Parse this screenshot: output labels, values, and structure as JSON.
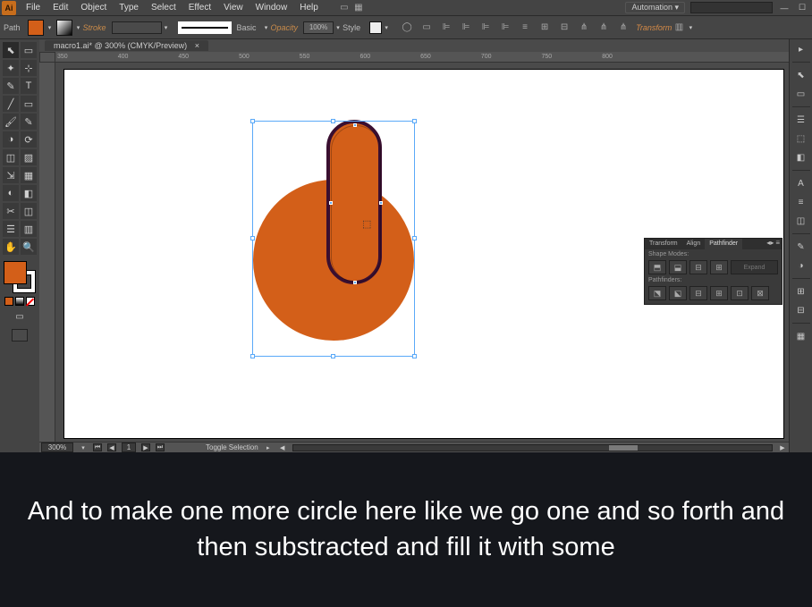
{
  "menubar": {
    "logo": "Ai",
    "items": [
      "File",
      "Edit",
      "Object",
      "Type",
      "Select",
      "Effect",
      "View",
      "Window",
      "Help"
    ],
    "automation_label": "Automation",
    "search_placeholder": ""
  },
  "controlbar": {
    "selection_label": "Path",
    "stroke_label": "Stroke",
    "line_style_label": "Basic",
    "opacity_label": "Opacity",
    "opacity_value": "100%",
    "style_label": "Style",
    "transform_label": "Transform"
  },
  "document": {
    "tab_title": "macro1.ai* @ 300% (CMYK/Preview)",
    "ruler_marks": [
      "350",
      "400",
      "450",
      "500",
      "550",
      "600",
      "650",
      "700",
      "750",
      "800"
    ],
    "zoom": "300%",
    "artboard_page": "1",
    "status_mode": "Toggle Selection"
  },
  "colors": {
    "fill": "#d35f19",
    "pill_stroke": "#3a0f30"
  },
  "tools_left": [
    [
      "⬉",
      "▭"
    ],
    [
      "✦",
      "⊹"
    ],
    [
      "✎",
      "T"
    ],
    [
      "╱",
      "▭"
    ],
    [
      "🖌",
      "✎"
    ],
    [
      "◑",
      "⟳"
    ],
    [
      "◫",
      "▨"
    ],
    [
      "⇲",
      "▦"
    ],
    [
      "◐",
      "◧"
    ],
    [
      "✂",
      "◫"
    ],
    [
      "☰",
      "▥"
    ],
    [
      "✋",
      "🔍"
    ]
  ],
  "dock_right": [
    "⬉",
    "▭",
    "☰",
    "⬚",
    "◧",
    "A",
    "≡",
    "◫",
    "✎",
    "◑",
    "⊞",
    "⊟",
    "▦"
  ],
  "control_icons": [
    "◯",
    "▭",
    "⊫",
    "⊫",
    "⊫",
    "⊫",
    "≡",
    "⊞",
    "⊟",
    "⋔",
    "⋔",
    "⋔"
  ],
  "pathfinder": {
    "tabs": [
      "Transform",
      "Align",
      "Pathfinder"
    ],
    "shape_modes_label": "Shape Modes:",
    "pathfinders_label": "Pathfinders:",
    "expand_label": "Expand",
    "shape_mode_icons": [
      "⬒",
      "⬓",
      "⊟",
      "⊞"
    ],
    "pathfinder_icons": [
      "⬔",
      "⬕",
      "⊟",
      "⊞",
      "⊡",
      "⊠"
    ]
  },
  "subtitle": "And to make one more circle here like we go one and so forth and then substracted and fill it with some"
}
